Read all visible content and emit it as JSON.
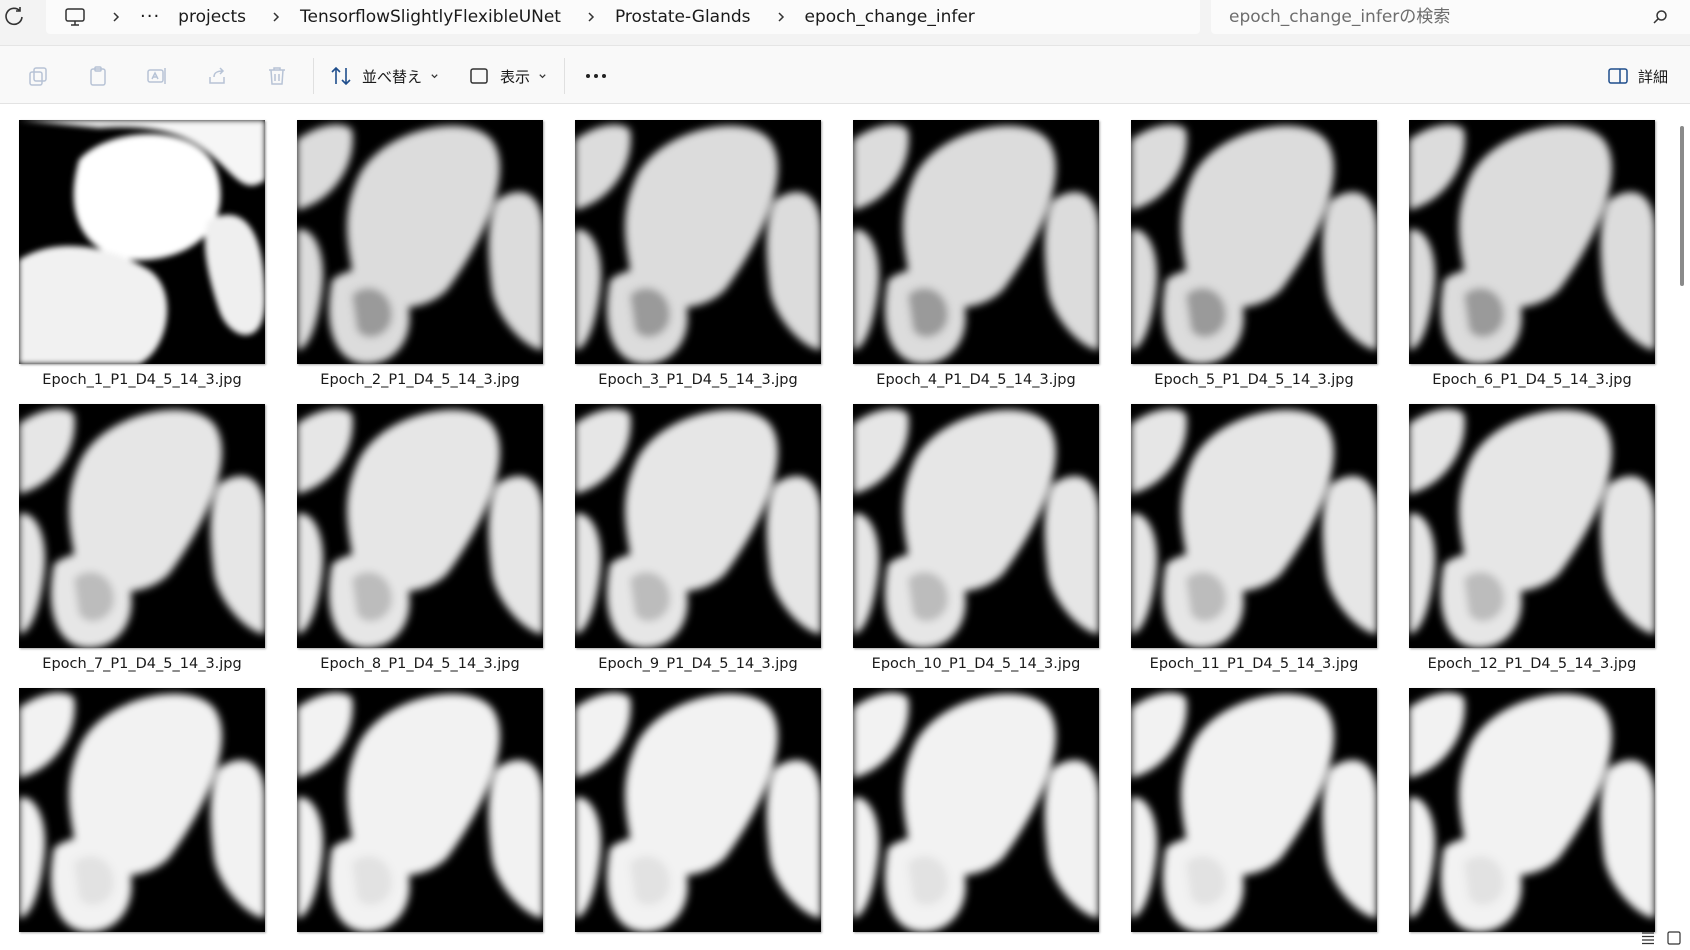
{
  "address_bar": {
    "crumbs": [
      "projects",
      "TensorflowSlightlyFlexibleUNet",
      "Prostate-Glands",
      "epoch_change_infer"
    ]
  },
  "search": {
    "placeholder": "epoch_change_inferの検索"
  },
  "toolbar": {
    "sort_label": "並べ替え",
    "view_label": "表示",
    "details_label": "詳細"
  },
  "files": [
    "Epoch_1_P1_D4_5_14_3.jpg",
    "Epoch_2_P1_D4_5_14_3.jpg",
    "Epoch_3_P1_D4_5_14_3.jpg",
    "Epoch_4_P1_D4_5_14_3.jpg",
    "Epoch_5_P1_D4_5_14_3.jpg",
    "Epoch_6_P1_D4_5_14_3.jpg",
    "Epoch_7_P1_D4_5_14_3.jpg",
    "Epoch_8_P1_D4_5_14_3.jpg",
    "Epoch_9_P1_D4_5_14_3.jpg",
    "Epoch_10_P1_D4_5_14_3.jpg",
    "Epoch_11_P1_D4_5_14_3.jpg",
    "Epoch_12_P1_D4_5_14_3.jpg",
    "",
    "",
    "",
    "",
    "",
    ""
  ],
  "thumbnail_tint": "#ffffff",
  "thumbnail_bg": "#000000"
}
